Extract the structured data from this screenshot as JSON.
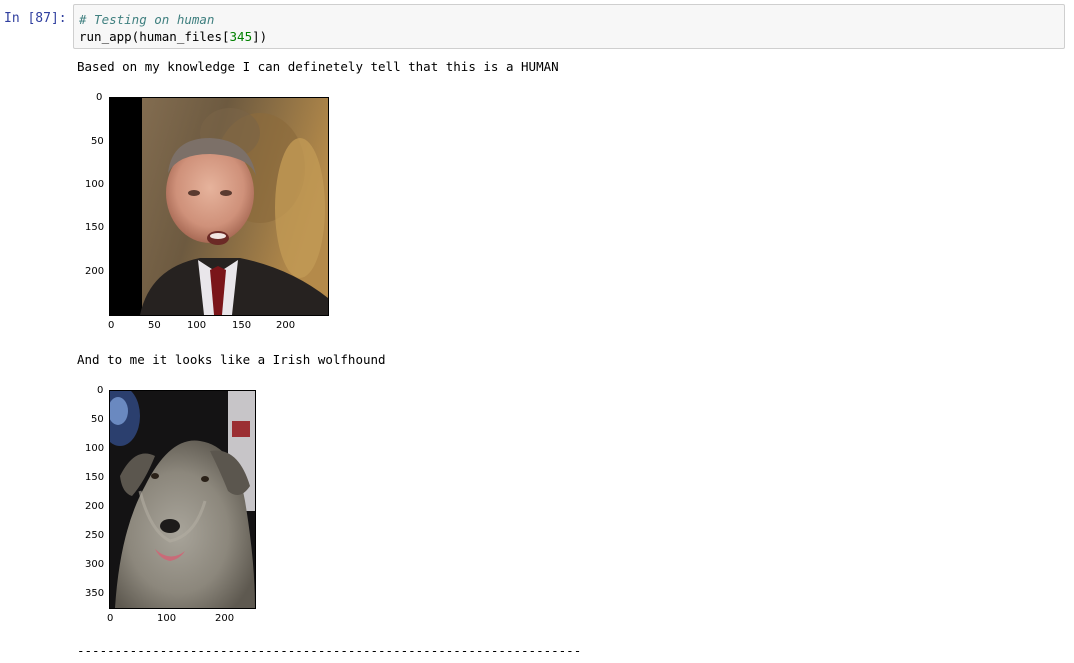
{
  "cell": {
    "prompt": "In [87]:",
    "code": {
      "comment": "# Testing on human",
      "call_prefix": "run_app(human_files[",
      "call_number": "345",
      "call_suffix": "])"
    }
  },
  "output": {
    "line1": "Based on my knowledge I can definetely tell that this is a HUMAN",
    "line2": "And to me it looks like a Irish wolfhound",
    "separator": "-------------------------------------------------------------------"
  },
  "plot1": {
    "y_ticks": [
      "0",
      "50",
      "100",
      "150",
      "200"
    ],
    "x_ticks": [
      "0",
      "50",
      "100",
      "150",
      "200"
    ]
  },
  "plot2": {
    "y_ticks": [
      "0",
      "50",
      "100",
      "150",
      "200",
      "250",
      "300",
      "350"
    ],
    "x_ticks": [
      "0",
      "100",
      "200"
    ]
  }
}
